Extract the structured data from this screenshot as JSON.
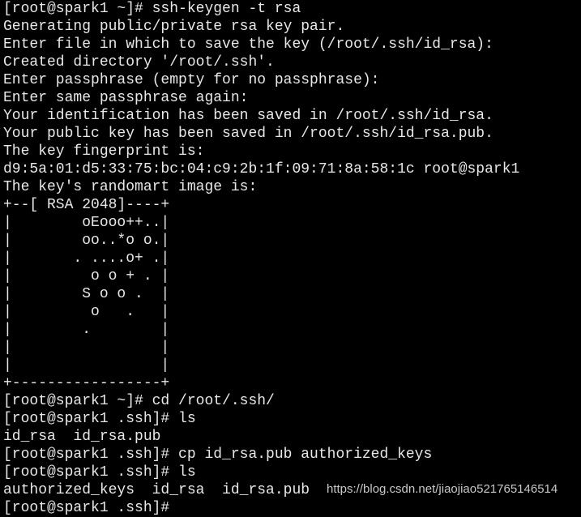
{
  "terminal": {
    "lines": [
      "[root@spark1 ~]# ssh-keygen -t rsa",
      "Generating public/private rsa key pair.",
      "Enter file in which to save the key (/root/.ssh/id_rsa):",
      "Created directory '/root/.ssh'.",
      "Enter passphrase (empty for no passphrase):",
      "Enter same passphrase again:",
      "Your identification has been saved in /root/.ssh/id_rsa.",
      "Your public key has been saved in /root/.ssh/id_rsa.pub.",
      "The key fingerprint is:",
      "d9:5a:01:d5:33:75:bc:04:c9:2b:1f:09:71:8a:58:1c root@spark1",
      "The key's randomart image is:",
      "+--[ RSA 2048]----+",
      "|        oEooo++..|",
      "|        oo..*o o.|",
      "|       . ....o+ .|",
      "|         o o + . |",
      "|        S o o .  |",
      "|         o   .   |",
      "|        .        |",
      "|                 |",
      "|                 |",
      "+-----------------+",
      "[root@spark1 ~]# cd /root/.ssh/",
      "[root@spark1 .ssh]# ls",
      "id_rsa  id_rsa.pub",
      "[root@spark1 .ssh]# cp id_rsa.pub authorized_keys",
      "[root@spark1 .ssh]# ls",
      "authorized_keys  id_rsa  id_rsa.pub",
      "[root@spark1 .ssh]#"
    ]
  },
  "watermark": "https://blog.csdn.net/jiaojiao521765146514"
}
